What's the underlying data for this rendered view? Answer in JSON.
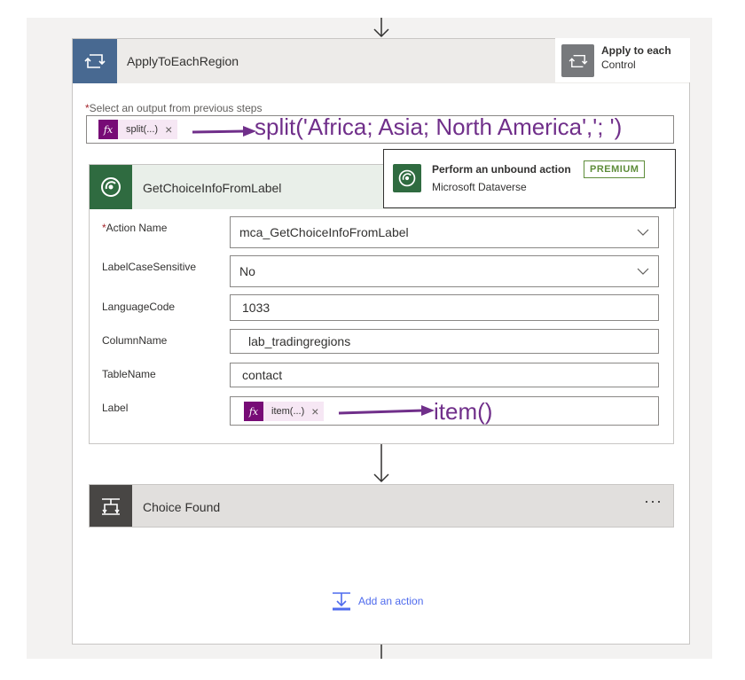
{
  "loop": {
    "title": "ApplyToEachRegion",
    "icon": "loop-icon",
    "color": "#486991"
  },
  "tooltip": {
    "title": "Apply to each",
    "subtitle": "Control"
  },
  "select_output": {
    "required_mark": "*",
    "label": "Select an output from previous steps",
    "token_label": "split(...)",
    "token_remove": "×"
  },
  "annotations": {
    "split": "split('Africa; Asia; North America','; ')",
    "item": "item()"
  },
  "action": {
    "title": "GetChoiceInfoFromLabel",
    "icon": "dataverse-icon",
    "color": "#2f6b40",
    "fields": [
      {
        "label": "Action Name",
        "required": "*",
        "value": "mca_GetChoiceInfoFromLabel"
      },
      {
        "label": "LabelCaseSensitive",
        "value": "No"
      },
      {
        "label": "LanguageCode",
        "value": "1033"
      },
      {
        "label": "ColumnName",
        "value": "lab_tradingregions"
      },
      {
        "label": "TableName",
        "value": "contact"
      },
      {
        "label": "Label",
        "token_label": "item(...)",
        "token_remove": "×"
      }
    ]
  },
  "popup": {
    "title": "Perform an unbound action",
    "badge": "PREMIUM",
    "subtitle": "Microsoft Dataverse"
  },
  "condition": {
    "title": "Choice Found",
    "more": "···",
    "icon": "condition-icon"
  },
  "add_action": {
    "label": "Add an action",
    "icon": "add-action-icon"
  },
  "colors": {
    "token_fx": "#770b76",
    "annotation": "#702f8a",
    "premium": "#5e8d3a",
    "link": "#4f6bed"
  }
}
